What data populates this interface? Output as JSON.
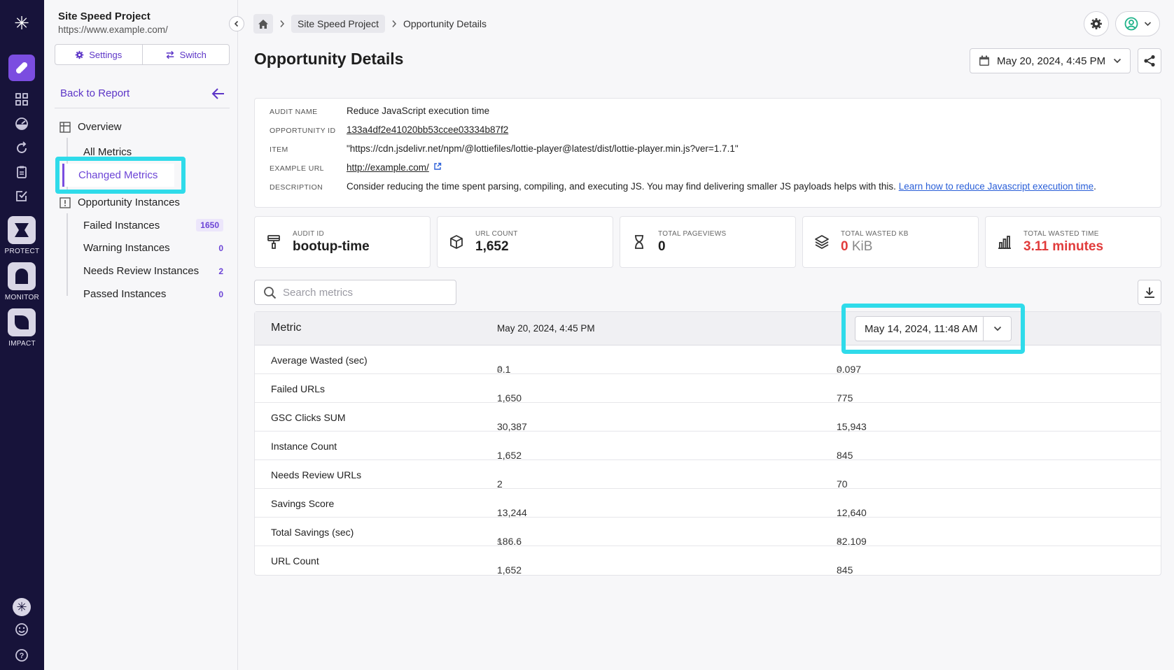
{
  "project": {
    "name": "Site Speed Project",
    "url": "https://www.example.com/",
    "settings_label": "Settings",
    "switch_label": "Switch"
  },
  "rail": {
    "protect_label": "PROTECT",
    "monitor_label": "MONITOR",
    "impact_label": "IMPACT"
  },
  "sidebar": {
    "back_label": "Back to Report",
    "overview_label": "Overview",
    "all_metrics": "All Metrics",
    "changed_metrics": "Changed Metrics",
    "instances_label": "Opportunity Instances",
    "instances": [
      {
        "label": "Failed Instances",
        "count": "1650"
      },
      {
        "label": "Warning Instances",
        "count": "0"
      },
      {
        "label": "Needs Review Instances",
        "count": "2"
      },
      {
        "label": "Passed Instances",
        "count": "0"
      }
    ]
  },
  "breadcrumb": {
    "project": "Site Speed Project",
    "current": "Opportunity Details"
  },
  "page": {
    "title": "Opportunity Details",
    "date": "May 20, 2024, 4:45 PM"
  },
  "info": {
    "audit_name_key": "AUDIT NAME",
    "audit_name": "Reduce JavaScript execution time",
    "opportunity_id_key": "OPPORTUNITY ID",
    "opportunity_id": "133a4df2e41020bb53ccee03334b87f2",
    "item_key": "ITEM",
    "item": "\"https://cdn.jsdelivr.net/npm/@lottiefiles/lottie-player@latest/dist/lottie-player.min.js?ver=1.7.1\"",
    "example_url_key": "EXAMPLE URL",
    "example_url": "http://example.com/",
    "description_key": "DESCRIPTION",
    "description": "Consider reducing the time spent parsing, compiling, and executing JS. You may find delivering smaller JS payloads helps with this.",
    "description_link": "Learn how to reduce Javascript execution time",
    "description_end": "."
  },
  "cards": {
    "audit_id_label": "AUDIT ID",
    "audit_id": "bootup-time",
    "url_count_label": "URL COUNT",
    "url_count": "1,652",
    "pageviews_label": "TOTAL PAGEVIEWS",
    "pageviews": "0",
    "wasted_kb_label": "TOTAL WASTED KB",
    "wasted_kb_value": "0",
    "wasted_kb_unit": "KiB",
    "wasted_time_label": "TOTAL WASTED TIME",
    "wasted_time": "3.11 minutes"
  },
  "search": {
    "placeholder": "Search metrics"
  },
  "table": {
    "col_metric": "Metric",
    "col_current": "May 20, 2024, 4:45 PM",
    "compare_date": "May 14, 2024, 11:48 AM",
    "rows": [
      {
        "metric": "Average Wasted (sec)",
        "current": "0.1",
        "current_unit": "s",
        "previous": "0.097",
        "previous_unit": "s"
      },
      {
        "metric": "Failed URLs",
        "current": "1,650",
        "current_unit": "",
        "previous": "775",
        "previous_unit": ""
      },
      {
        "metric": "GSC Clicks SUM",
        "current": "30,387",
        "current_unit": "",
        "previous": "15,943",
        "previous_unit": ""
      },
      {
        "metric": "Instance Count",
        "current": "1,652",
        "current_unit": "",
        "previous": "845",
        "previous_unit": ""
      },
      {
        "metric": "Needs Review URLs",
        "current": "2",
        "current_unit": "",
        "previous": "70",
        "previous_unit": ""
      },
      {
        "metric": "Savings Score",
        "current": "13,244",
        "current_unit": "",
        "previous": "12,640",
        "previous_unit": ""
      },
      {
        "metric": "Total Savings (sec)",
        "current": "186.6",
        "current_unit": "s",
        "previous": "82.109",
        "previous_unit": "s"
      },
      {
        "metric": "URL Count",
        "current": "1,652",
        "current_unit": "",
        "previous": "845",
        "previous_unit": ""
      }
    ]
  },
  "colors": {
    "accent": "#7b4de0",
    "highlight": "#2fdbea",
    "rail": "#17133a",
    "danger": "#e13b3b"
  }
}
